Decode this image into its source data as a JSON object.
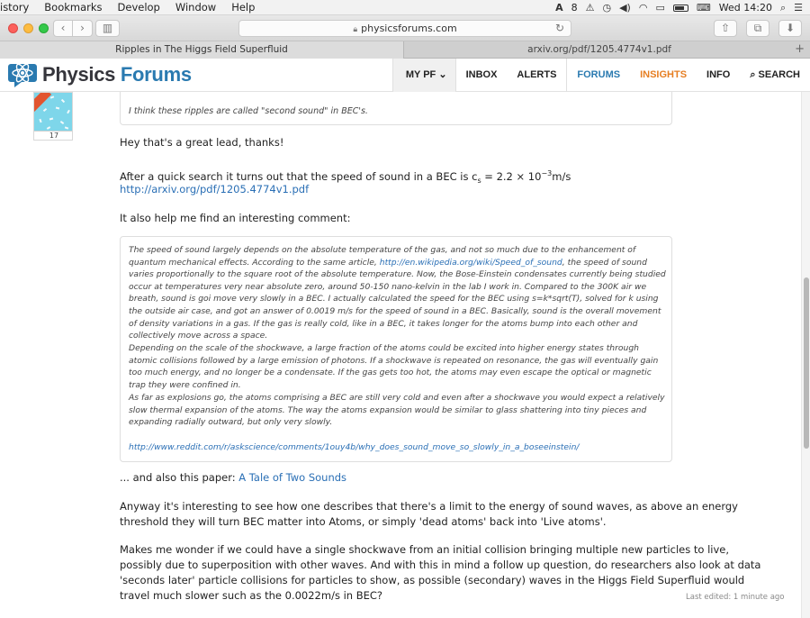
{
  "menubar": {
    "menus": [
      "istory",
      "Bookmarks",
      "Develop",
      "Window",
      "Help"
    ],
    "status_number": "8",
    "clock": "Wed 14:20"
  },
  "toolbar": {
    "url": "physicsforums.com"
  },
  "tabs": [
    {
      "title": "Ripples in The Higgs Field Superfluid",
      "active": true
    },
    {
      "title": "arxiv.org/pdf/1205.4774v1.pdf",
      "active": false
    }
  ],
  "site": {
    "logo_word1": "Physics",
    "logo_word2": "Forums",
    "nav": {
      "mypf": "MY PF",
      "inbox": "INBOX",
      "alerts": "ALERTS",
      "forums": "FORUMS",
      "insights": "INSIGHTS",
      "info": "INFO",
      "search": "SEARCH"
    },
    "colors": {
      "brand_blue": "#2a7ab0",
      "insights_orange": "#e67e22"
    }
  },
  "post": {
    "avatar_count": "17",
    "quote_top": "I think these ripples are called \"second sound\" in BEC's.",
    "line1": "Hey that's a great lead, thanks!",
    "line2_pre": "After a quick search it turns out that the speed of sound in a BEC is c",
    "line2_sub": "s",
    "line2_mid": " = 2.2 × 10",
    "line2_sup": "−3",
    "line2_post": "m/s",
    "arxiv_link": "http://arxiv.org/pdf/1205.4774v1.pdf",
    "line3": "It also help me find an interesting comment:",
    "quote": {
      "p1a": "The speed of sound largely depends on the absolute temperature of the gas, and not so much due to the enhancement of quantum mechanical effects. According to the same article, ",
      "p1_link": "http://en.wikipedia.org/wiki/Speed_of_sound",
      "p1b": ", the speed of sound varies proportionally to the square root of the absolute temperature. Now, the Bose-Einstein condensates currently being studied occur at temperatures very near absolute zero, around 50-150 nano-kelvin in the lab I work in. Compared to the 300K air we breath, sound is goi move very slowly in a BEC. I actually calculated the speed for the BEC using s=k*sqrt(T), solved for k using the outside air case, and got an answer of 0.0019 m/s for the speed of sound in a BEC. Basically, sound is the overall movement of density variations in a gas. If the gas is really cold, like in a BEC, it takes longer for the atoms bump into each other and collectively move across a space.",
      "p2": "Depending on the scale of the shockwave, a large fraction of the atoms could be excited into higher energy states through atomic collisions followed by a large emission of photons. If a shockwave is repeated on resonance, the gas will eventually gain too much energy, and no longer be a condensate. If the gas gets too hot, the atoms may even escape the optical or magnetic trap they were confined in.",
      "p3": "As far as explosions go, the atoms comprising a BEC are still very cold and even after a shockwave you would expect a relatively slow thermal expansion of the atoms. The way the atoms expansion would be similar to glass shattering into tiny pieces and expanding radially outward, but only very slowly.",
      "reddit_link": "http://www.reddit.com/r/askscience/comments/1ouy4b/why_does_sound_move_so_slowly_in_a_boseeinstein/"
    },
    "line4_pre": "... and also this paper: ",
    "line4_link": "A Tale of Two Sounds",
    "line5": "Anyway it's interesting to see how one describes that there's a limit to the energy of sound waves, as above an energy threshold they will turn BEC matter into Atoms, or simply 'dead atoms' back into 'Live atoms'.",
    "line6": "Makes me wonder if we could have a single shockwave from an initial collision bringing multiple new particles to live, possibly due to superposition with other waves. And with this in mind a follow up question, do researchers also look at data 'seconds later' particle collisions for particles to show, as possible (secondary) waves in the Higgs Field Superfluid would travel much slower such as the 0.0022m/s in BEC?",
    "last_edited": "Last edited: 1 minute ago"
  }
}
